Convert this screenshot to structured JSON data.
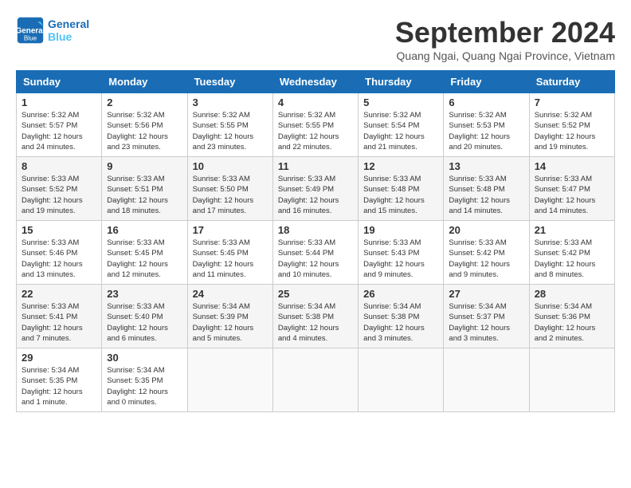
{
  "header": {
    "logo_line1": "General",
    "logo_line2": "Blue",
    "month_title": "September 2024",
    "location": "Quang Ngai, Quang Ngai Province, Vietnam"
  },
  "days_of_week": [
    "Sunday",
    "Monday",
    "Tuesday",
    "Wednesday",
    "Thursday",
    "Friday",
    "Saturday"
  ],
  "weeks": [
    [
      {
        "day": "1",
        "sunrise": "5:32 AM",
        "sunset": "5:57 PM",
        "daylight": "12 hours and 24 minutes."
      },
      {
        "day": "2",
        "sunrise": "5:32 AM",
        "sunset": "5:56 PM",
        "daylight": "12 hours and 23 minutes."
      },
      {
        "day": "3",
        "sunrise": "5:32 AM",
        "sunset": "5:55 PM",
        "daylight": "12 hours and 23 minutes."
      },
      {
        "day": "4",
        "sunrise": "5:32 AM",
        "sunset": "5:55 PM",
        "daylight": "12 hours and 22 minutes."
      },
      {
        "day": "5",
        "sunrise": "5:32 AM",
        "sunset": "5:54 PM",
        "daylight": "12 hours and 21 minutes."
      },
      {
        "day": "6",
        "sunrise": "5:32 AM",
        "sunset": "5:53 PM",
        "daylight": "12 hours and 20 minutes."
      },
      {
        "day": "7",
        "sunrise": "5:32 AM",
        "sunset": "5:52 PM",
        "daylight": "12 hours and 19 minutes."
      }
    ],
    [
      {
        "day": "8",
        "sunrise": "5:33 AM",
        "sunset": "5:52 PM",
        "daylight": "12 hours and 19 minutes."
      },
      {
        "day": "9",
        "sunrise": "5:33 AM",
        "sunset": "5:51 PM",
        "daylight": "12 hours and 18 minutes."
      },
      {
        "day": "10",
        "sunrise": "5:33 AM",
        "sunset": "5:50 PM",
        "daylight": "12 hours and 17 minutes."
      },
      {
        "day": "11",
        "sunrise": "5:33 AM",
        "sunset": "5:49 PM",
        "daylight": "12 hours and 16 minutes."
      },
      {
        "day": "12",
        "sunrise": "5:33 AM",
        "sunset": "5:48 PM",
        "daylight": "12 hours and 15 minutes."
      },
      {
        "day": "13",
        "sunrise": "5:33 AM",
        "sunset": "5:48 PM",
        "daylight": "12 hours and 14 minutes."
      },
      {
        "day": "14",
        "sunrise": "5:33 AM",
        "sunset": "5:47 PM",
        "daylight": "12 hours and 14 minutes."
      }
    ],
    [
      {
        "day": "15",
        "sunrise": "5:33 AM",
        "sunset": "5:46 PM",
        "daylight": "12 hours and 13 minutes."
      },
      {
        "day": "16",
        "sunrise": "5:33 AM",
        "sunset": "5:45 PM",
        "daylight": "12 hours and 12 minutes."
      },
      {
        "day": "17",
        "sunrise": "5:33 AM",
        "sunset": "5:45 PM",
        "daylight": "12 hours and 11 minutes."
      },
      {
        "day": "18",
        "sunrise": "5:33 AM",
        "sunset": "5:44 PM",
        "daylight": "12 hours and 10 minutes."
      },
      {
        "day": "19",
        "sunrise": "5:33 AM",
        "sunset": "5:43 PM",
        "daylight": "12 hours and 9 minutes."
      },
      {
        "day": "20",
        "sunrise": "5:33 AM",
        "sunset": "5:42 PM",
        "daylight": "12 hours and 9 minutes."
      },
      {
        "day": "21",
        "sunrise": "5:33 AM",
        "sunset": "5:42 PM",
        "daylight": "12 hours and 8 minutes."
      }
    ],
    [
      {
        "day": "22",
        "sunrise": "5:33 AM",
        "sunset": "5:41 PM",
        "daylight": "12 hours and 7 minutes."
      },
      {
        "day": "23",
        "sunrise": "5:33 AM",
        "sunset": "5:40 PM",
        "daylight": "12 hours and 6 minutes."
      },
      {
        "day": "24",
        "sunrise": "5:34 AM",
        "sunset": "5:39 PM",
        "daylight": "12 hours and 5 minutes."
      },
      {
        "day": "25",
        "sunrise": "5:34 AM",
        "sunset": "5:38 PM",
        "daylight": "12 hours and 4 minutes."
      },
      {
        "day": "26",
        "sunrise": "5:34 AM",
        "sunset": "5:38 PM",
        "daylight": "12 hours and 3 minutes."
      },
      {
        "day": "27",
        "sunrise": "5:34 AM",
        "sunset": "5:37 PM",
        "daylight": "12 hours and 3 minutes."
      },
      {
        "day": "28",
        "sunrise": "5:34 AM",
        "sunset": "5:36 PM",
        "daylight": "12 hours and 2 minutes."
      }
    ],
    [
      {
        "day": "29",
        "sunrise": "5:34 AM",
        "sunset": "5:35 PM",
        "daylight": "12 hours and 1 minute."
      },
      {
        "day": "30",
        "sunrise": "5:34 AM",
        "sunset": "5:35 PM",
        "daylight": "12 hours and 0 minutes."
      },
      null,
      null,
      null,
      null,
      null
    ]
  ],
  "labels": {
    "sunrise": "Sunrise: ",
    "sunset": "Sunset: ",
    "daylight": "Daylight: "
  }
}
